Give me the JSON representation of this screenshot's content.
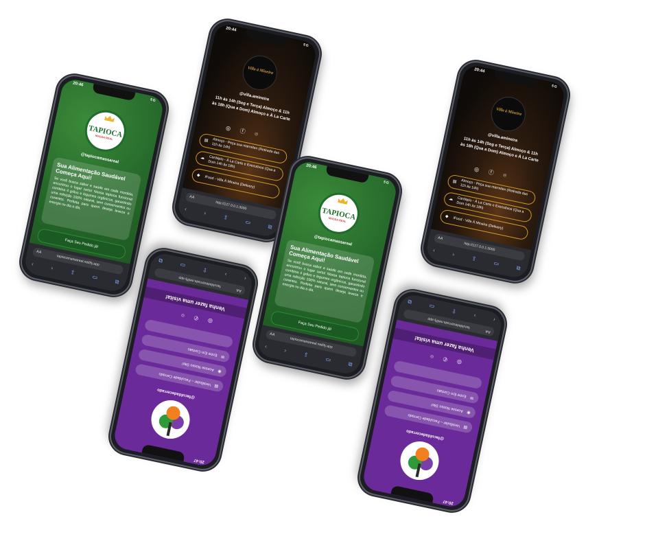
{
  "colors": {
    "tapioca_green": "#25682a",
    "villa_gold": "#d19a2a",
    "purple": "#6a2a9a"
  },
  "tapioca": {
    "time": "20:46",
    "signal": "5G",
    "logo_title": "TAPIOCA",
    "logo_sub": "MASSA REAL",
    "handle": "@tapiocamassareal",
    "card_title": "Sua Alimentação Saudável Começa Aqui!",
    "card_body": "Se você busca sabor e saúde em cada mordida, encontrou o lugar certo! Nossa tapioca funcional combina 4 grãos e legumes orgânicos, garantindo uma refeição 100% natural, sem conservantes ou corantes. Perfeita para quem deseja leveza e energia no dia a dia.",
    "order_button": "Faça Seu Pedido já!",
    "url": "tapiocamassareal.netlify.app"
  },
  "villa": {
    "time": "20:44",
    "signal": "5G",
    "logo": "Villa à Mineira",
    "handle": "@villa.amineira",
    "hours_1": "11h às 14h (Seg e Terça) Almoço & 11h",
    "hours_2": "às 18h (Qua a Dom) Almoço e À La Carte",
    "btn_1": "Almoço - Peça sua marmitex (Retirada das 11h às 14h)",
    "btn_2": "Cardápio - À La Carte e Executivos (Qua a Dom 14h às 18h)",
    "btn_3": "iFood - Villa À Mineira (Delivery)",
    "url": "http://127.0.0.1:3000"
  },
  "cerrado": {
    "time": "20:47",
    "handle": "@faculdadecerrado",
    "btn_1": "Vestibular – Faculdade Cerrado",
    "btn_2": "Acesse Nosso Site!",
    "btn_3": "Entre Em Contato",
    "title": "Venha fazer uma visita!",
    "url": "faculdadecerrado.netlify.app"
  }
}
